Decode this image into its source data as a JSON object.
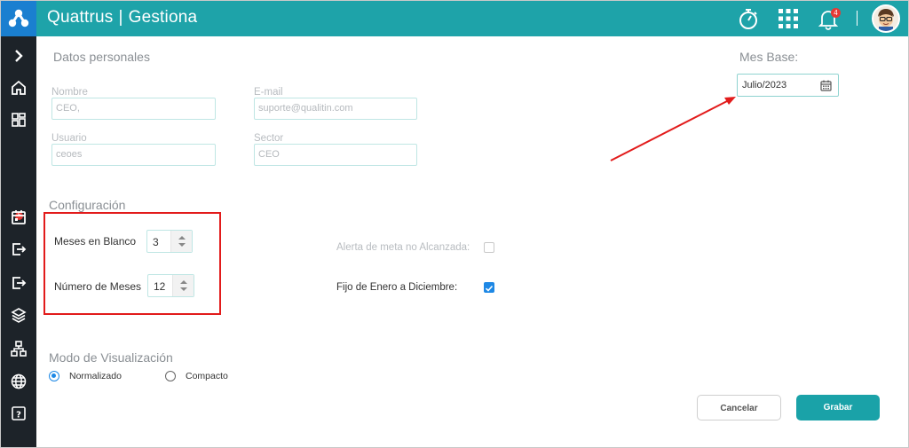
{
  "header": {
    "brand": "Quattrus",
    "separator": "|",
    "module": "Gestiona",
    "notification_count": "4"
  },
  "sidebar": {
    "badge_count": "5",
    "items": [
      "expand-icon",
      "home-icon",
      "dashboard-icon",
      "calendar-icon",
      "exit-icon",
      "logout-icon",
      "layers-icon",
      "org-chart-icon",
      "globe-icon",
      "help-icon"
    ]
  },
  "personal": {
    "title": "Datos personales",
    "name_label": "Nombre",
    "name_value": "CEO,",
    "email_label": "E-mail",
    "email_value": "suporte@qualitin.com",
    "user_label": "Usuario",
    "user_value": "ceoes",
    "sector_label": "Sector",
    "sector_value": "CEO"
  },
  "base_month": {
    "title": "Mes Base:",
    "value": "Julio/2023"
  },
  "config": {
    "title": "Configuración",
    "blank_months_label": "Meses en Blanco",
    "blank_months_value": "3",
    "num_months_label": "Número de Meses",
    "num_months_value": "12",
    "alert_label": "Alerta de meta no Alcanzada:",
    "alert_checked": false,
    "fixed_label": "Fijo de Enero a Diciembre:",
    "fixed_checked": true
  },
  "view_mode": {
    "title": "Modo de Visualización",
    "options": [
      "Normalizado",
      "Compacto"
    ],
    "selected": "Normalizado"
  },
  "actions": {
    "cancel": "Cancelar",
    "save": "Grabar"
  },
  "colors": {
    "topbar": "#1ea3a9",
    "sidebar": "#1d2329",
    "accent": "#1e88e5",
    "highlight": "#e21b1b"
  }
}
